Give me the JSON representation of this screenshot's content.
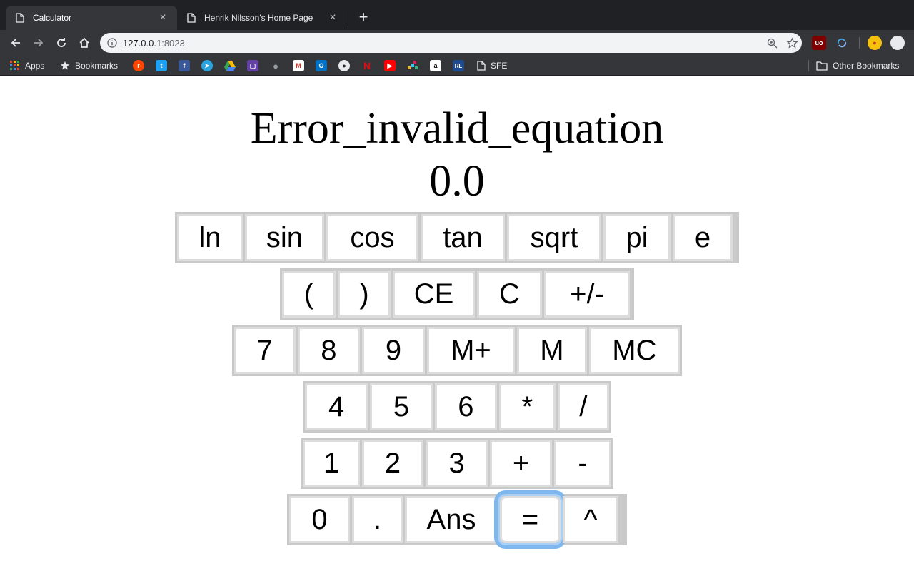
{
  "browser": {
    "tabs": [
      {
        "title": "Calculator",
        "active": true,
        "close": "×"
      },
      {
        "title": "Henrik Nilsson's Home Page",
        "active": false,
        "close": "×"
      }
    ],
    "new_tab": "+",
    "address": {
      "host": "127.0.0.1",
      "port": ":8023"
    },
    "bookmarks": [
      {
        "label": "Apps",
        "icon": "apps-grid-icon"
      },
      {
        "label": "Bookmarks",
        "icon": "star-icon"
      },
      {
        "label": "",
        "icon": "reddit-icon"
      },
      {
        "label": "",
        "icon": "twitter-icon"
      },
      {
        "label": "",
        "icon": "facebook-icon"
      },
      {
        "label": "",
        "icon": "telegram-icon"
      },
      {
        "label": "",
        "icon": "google-drive-icon"
      },
      {
        "label": "",
        "icon": "twitch-icon"
      },
      {
        "label": "",
        "icon": "apple-icon"
      },
      {
        "label": "",
        "icon": "gmail-icon"
      },
      {
        "label": "",
        "icon": "outlook-icon"
      },
      {
        "label": "",
        "icon": "github-icon"
      },
      {
        "label": "",
        "icon": "netflix-icon"
      },
      {
        "label": "",
        "icon": "youtube-icon"
      },
      {
        "label": "",
        "icon": "slack-icon"
      },
      {
        "label": "",
        "icon": "amazon-icon"
      },
      {
        "label": "",
        "icon": "rl-icon"
      },
      {
        "label": "SFE",
        "icon": "page-icon"
      }
    ],
    "other_bookmarks": "Other Bookmarks",
    "accent_colors": {
      "reddit": "#ff4500",
      "twitter": "#1da1f2",
      "facebook": "#3b5998",
      "telegram": "#2aa3df",
      "netflix": "#e50914",
      "youtube": "#ff0000",
      "ublock": "#800000"
    }
  },
  "calculator": {
    "error_text": "Error_invalid_equation",
    "value_text": "0.0",
    "rows": [
      [
        "ln",
        "sin",
        "cos",
        "tan",
        "sqrt",
        "pi",
        "e"
      ],
      [
        "(",
        ")",
        "CE",
        "C",
        "+/-"
      ],
      [
        "7",
        "8",
        "9",
        "M+",
        "M",
        "MC"
      ],
      [
        "4",
        "5",
        "6",
        "*",
        "/"
      ],
      [
        "1",
        "2",
        "3",
        "+",
        "-"
      ],
      [
        "0",
        ".",
        "Ans",
        "=",
        "^"
      ]
    ],
    "focused_key": "="
  }
}
